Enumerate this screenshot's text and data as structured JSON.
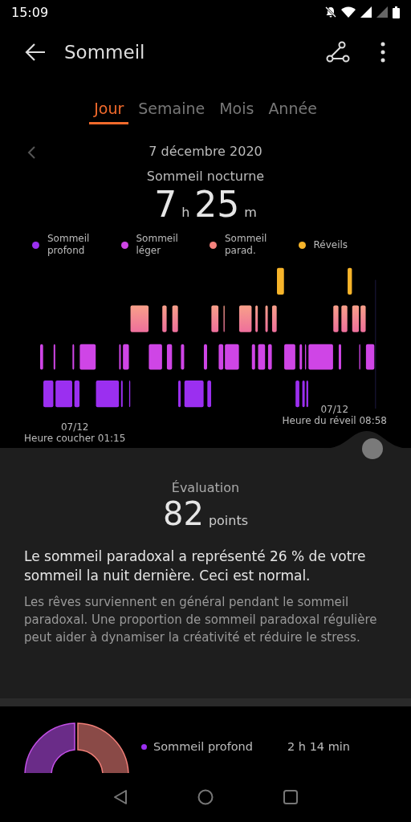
{
  "status_bar": {
    "time": "15:09"
  },
  "header": {
    "title": "Sommeil"
  },
  "tabs": [
    {
      "label": "Jour",
      "selected": true
    },
    {
      "label": "Semaine",
      "selected": false
    },
    {
      "label": "Mois",
      "selected": false
    },
    {
      "label": "Année",
      "selected": false
    }
  ],
  "date": "7 décembre 2020",
  "summary": {
    "title": "Sommeil nocturne",
    "hours": "7",
    "hours_unit": "h",
    "minutes": "25",
    "minutes_unit": "m"
  },
  "legend": [
    {
      "label": "Sommeil\nprofond",
      "color": "#9b2ff0"
    },
    {
      "label": "Sommeil\nléger",
      "color": "#cf45e6"
    },
    {
      "label": "Sommeil\nparad.",
      "color": "#f5837e"
    },
    {
      "label": "Réveils",
      "color": "#f6b42a"
    }
  ],
  "chart_labels": {
    "start_date": "07/12",
    "start": "Heure coucher 01:15",
    "end_date": "07/12",
    "end": "Heure du réveil 08:58"
  },
  "evaluation": {
    "label": "Évaluation",
    "score": "82",
    "unit": "points"
  },
  "headline": "Le sommeil paradoxal a représenté 26 % de votre sommeil la nuit dernière. Ceci est normal.",
  "body": "Les rêves surviennent en général pendant le sommeil paradoxal. Une proportion de sommeil paradoxal régulière peut aider à dynamiser la créativité et réduire le stress.",
  "breakdown": [
    {
      "label": "Sommeil profond",
      "value": "2 h 14 min",
      "color": "#9b2ff0"
    }
  ]
}
